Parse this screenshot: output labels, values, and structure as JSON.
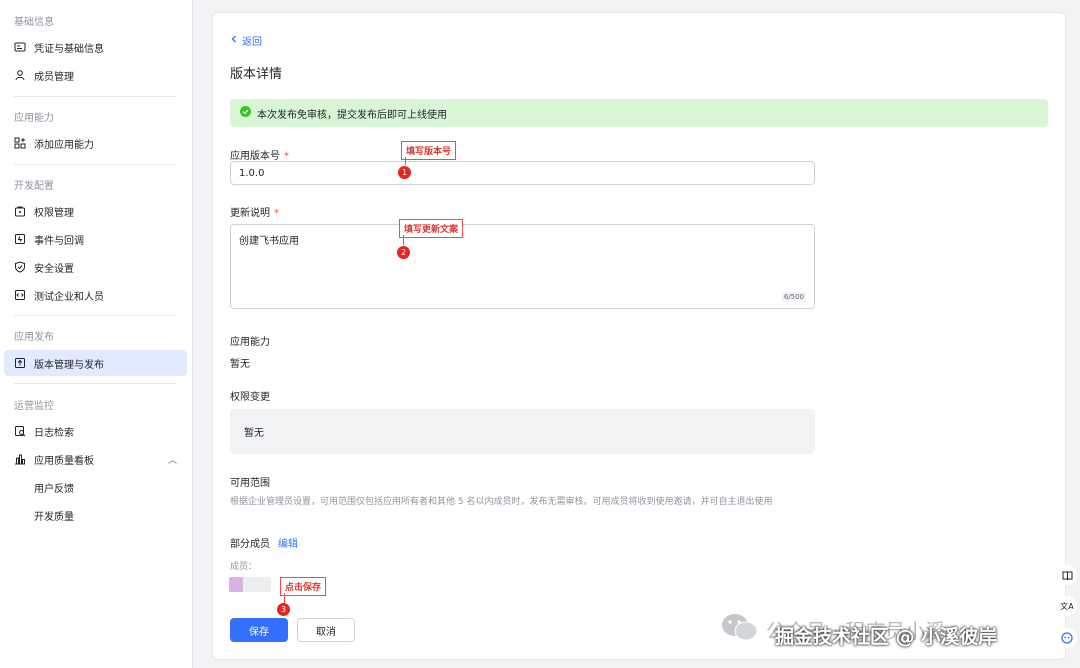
{
  "sidebar": {
    "sections": [
      {
        "title": "基础信息",
        "items": [
          "凭证与基础信息",
          "成员管理"
        ]
      },
      {
        "title": "应用能力",
        "items": [
          "添加应用能力"
        ]
      },
      {
        "title": "开发配置",
        "items": [
          "权限管理",
          "事件与回调",
          "安全设置",
          "测试企业和人员"
        ]
      },
      {
        "title": "应用发布",
        "items": [
          "版本管理与发布"
        ]
      },
      {
        "title": "运营监控",
        "items": [
          "日志检索",
          "应用质量看板"
        ],
        "subitems": [
          "用户反馈",
          "开发质量"
        ]
      }
    ]
  },
  "main": {
    "back_label": "返回",
    "page_title": "版本详情",
    "banner_text": "本次发布免审核，提交发布后即可上线使用",
    "version_label": "应用版本号",
    "version_value": "1.0.0",
    "update_label": "更新说明",
    "update_value": "创建飞书应用",
    "update_counter": "6/500",
    "ability_label": "应用能力",
    "ability_value": "暂无",
    "permission_label": "权限变更",
    "permission_value": "暂无",
    "scope_label": "可用范围",
    "scope_desc": "根据企业管理员设置，可用范围仅包括应用所有者和其他 5 名以内成员时，发布无需审核。可用成员将收到使用邀请，并可自主退出使用",
    "scope_partial": "部分成员",
    "scope_edit": "编辑",
    "members_label": "成员：",
    "save_label": "保存",
    "cancel_label": "取消"
  },
  "annotations": {
    "a1": "填写版本号",
    "a2": "填写更新文案",
    "a3": "点击保存",
    "n1": "1",
    "n2": "2",
    "n3": "3"
  },
  "watermark": {
    "line1": "公众号 · 程序员小溪",
    "line2": "掘金技术社区 @ 小溪彼岸"
  },
  "colors": {
    "accent": "#3370ff",
    "success_bg": "#d9f5d6",
    "annotation_red": "#e4261d"
  }
}
